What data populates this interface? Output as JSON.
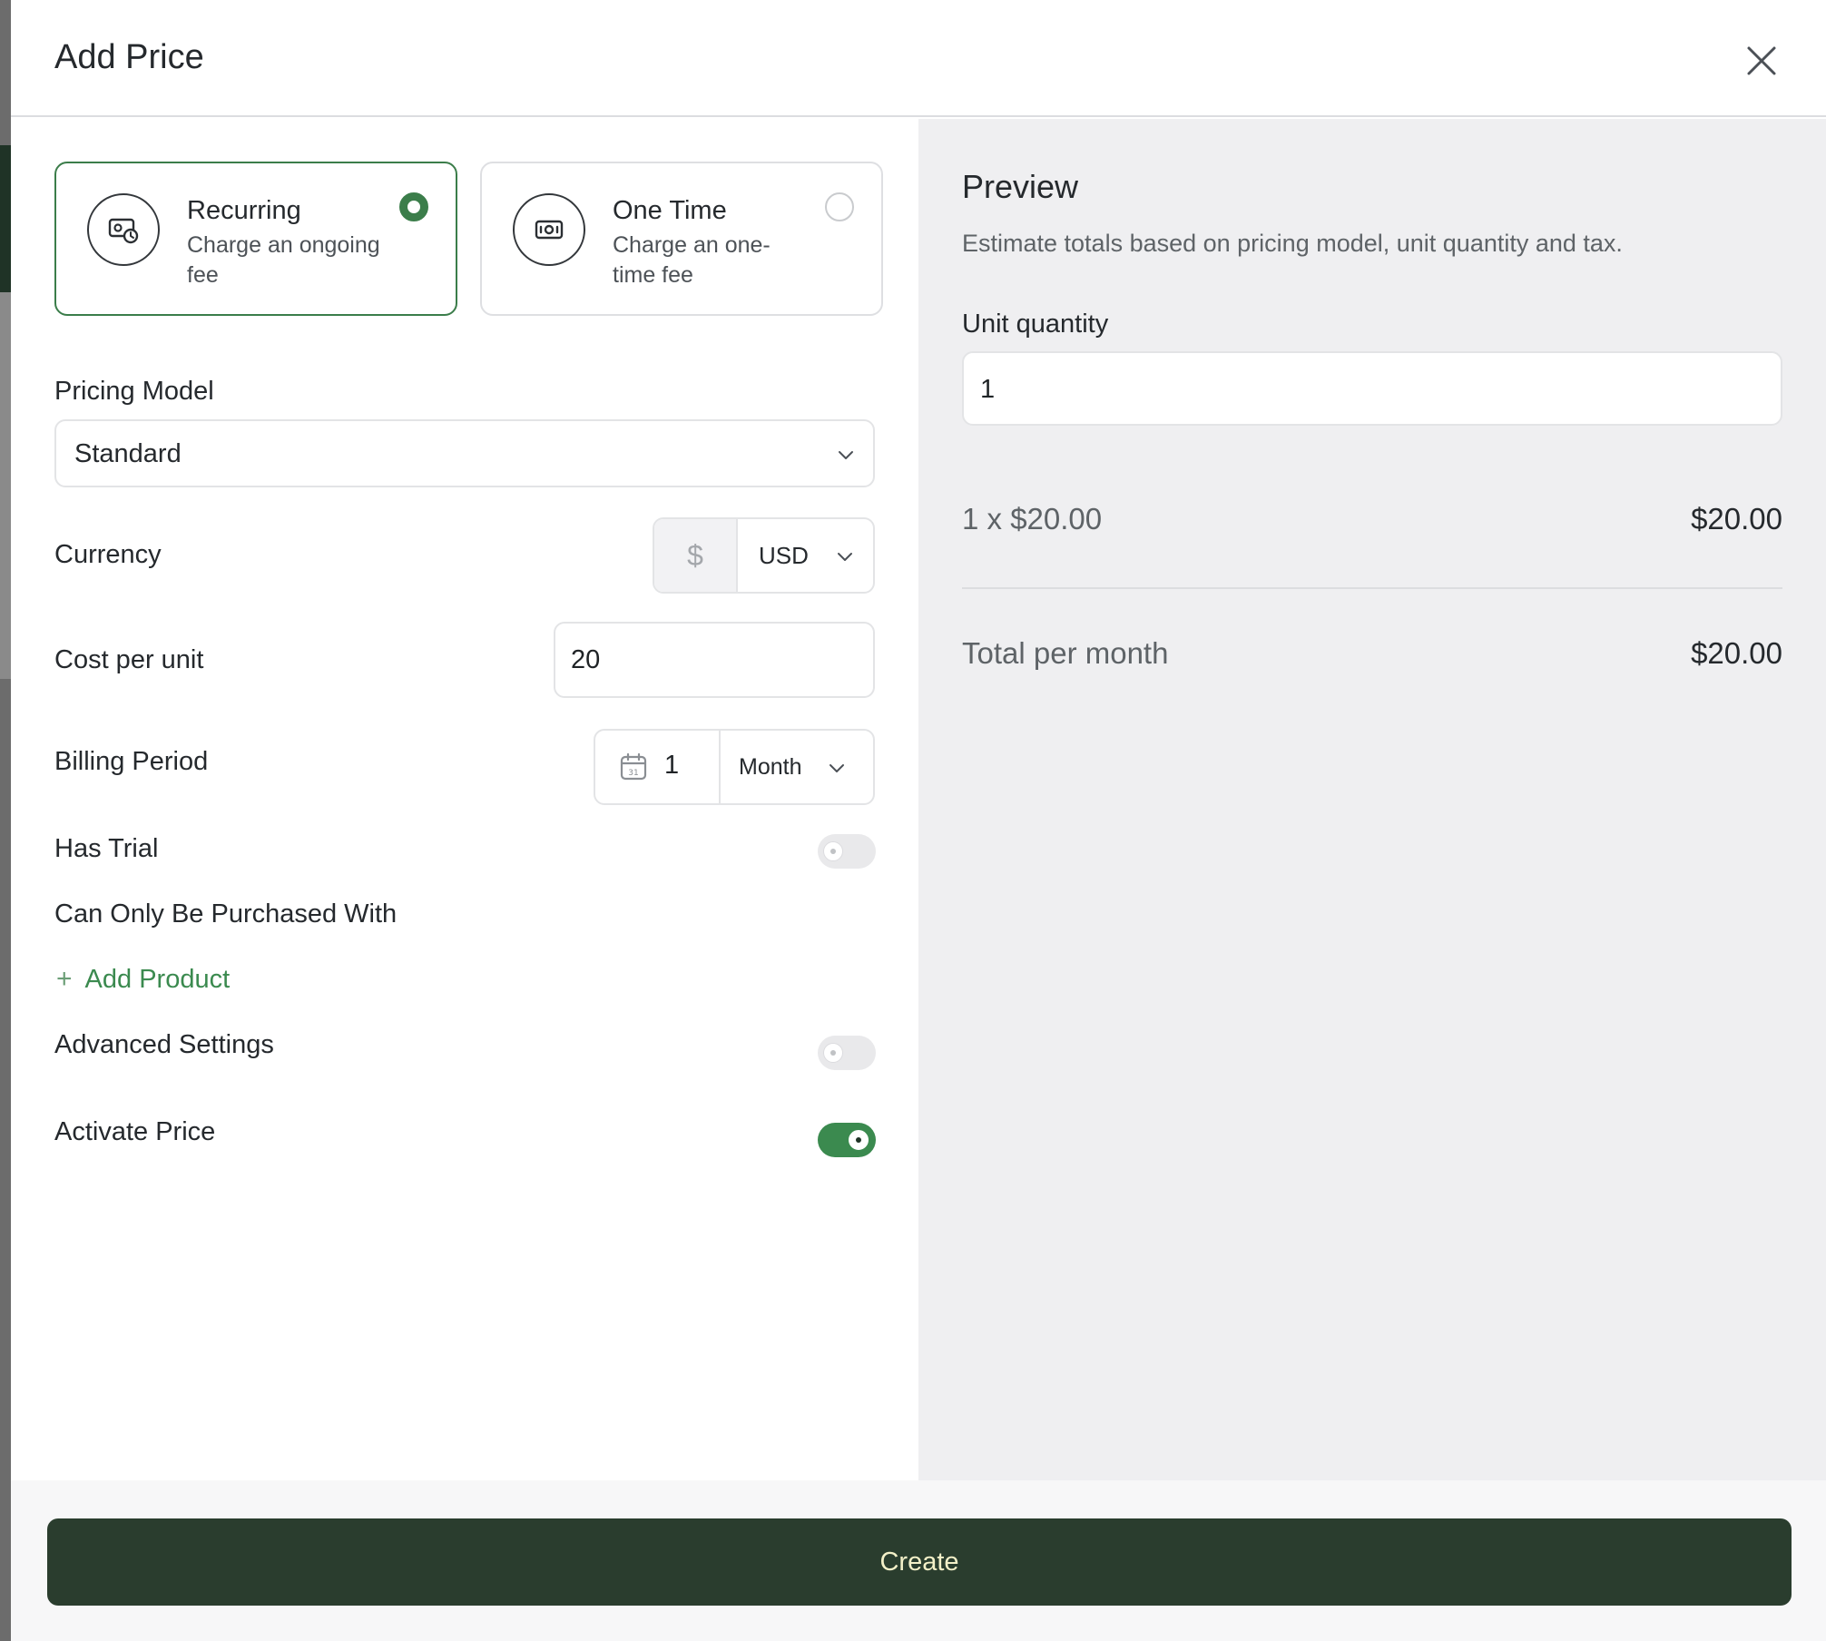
{
  "modal": {
    "title": "Add Price"
  },
  "price_types": [
    {
      "title": "Recurring",
      "description": "Charge an ongoing fee",
      "selected": true
    },
    {
      "title": "One Time",
      "description": "Charge an one-time fee",
      "selected": false
    }
  ],
  "form": {
    "pricing_model": {
      "label": "Pricing Model",
      "value": "Standard"
    },
    "currency": {
      "label": "Currency",
      "symbol": "$",
      "code": "USD"
    },
    "cost_per_unit": {
      "label": "Cost per unit",
      "value": "20"
    },
    "billing_period": {
      "label": "Billing Period",
      "count": "1",
      "unit": "Month"
    },
    "has_trial": {
      "label": "Has Trial",
      "on": false
    },
    "purchase_with": {
      "label": "Can Only Be Purchased With",
      "add_label": "Add Product"
    },
    "advanced_settings": {
      "label": "Advanced Settings",
      "on": false
    },
    "activate_price": {
      "label": "Activate Price",
      "on": true
    }
  },
  "preview": {
    "title": "Preview",
    "description": "Estimate totals based on pricing model, unit quantity and tax.",
    "unit_quantity_label": "Unit quantity",
    "unit_quantity": "1",
    "line_item": {
      "label": "1 x $20.00",
      "amount": "$20.00"
    },
    "total": {
      "label": "Total per month",
      "amount": "$20.00"
    }
  },
  "footer": {
    "create_label": "Create"
  },
  "colors": {
    "accent": "#3b8a4f",
    "button": "#2a3d2e",
    "preview_bg": "#efeff1"
  }
}
